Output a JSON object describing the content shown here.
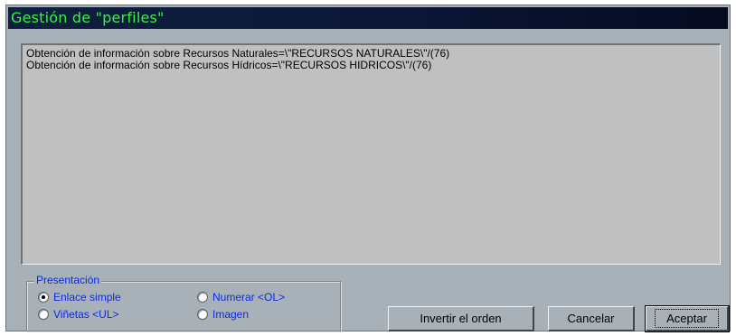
{
  "window": {
    "title": "Gestión de \"perfiles\""
  },
  "list": {
    "items": [
      "Obtención de información sobre Recursos Naturales=\\\"RECURSOS NATURALES\\\"/(76)",
      "Obtención de información sobre Recursos Hídricos=\\\"RECURSOS HIDRICOS\\\"/(76)"
    ]
  },
  "presentacion": {
    "legend": "Presentación",
    "options": [
      {
        "label": "Enlace simple",
        "selected": true
      },
      {
        "label": "Numerar <OL>",
        "selected": false
      },
      {
        "label": "Viñetas <UL>",
        "selected": false
      },
      {
        "label": "Imagen",
        "selected": false
      }
    ]
  },
  "buttons": {
    "invert": "Invertir el orden",
    "cancel": "Cancelar",
    "accept": "Aceptar"
  },
  "colors": {
    "title_text": "#35f243",
    "title_bar": "#0c1636",
    "dialog_bg": "#a8b1b8",
    "list_bg": "#c0c0c0",
    "option_text": "#0a2be0"
  }
}
